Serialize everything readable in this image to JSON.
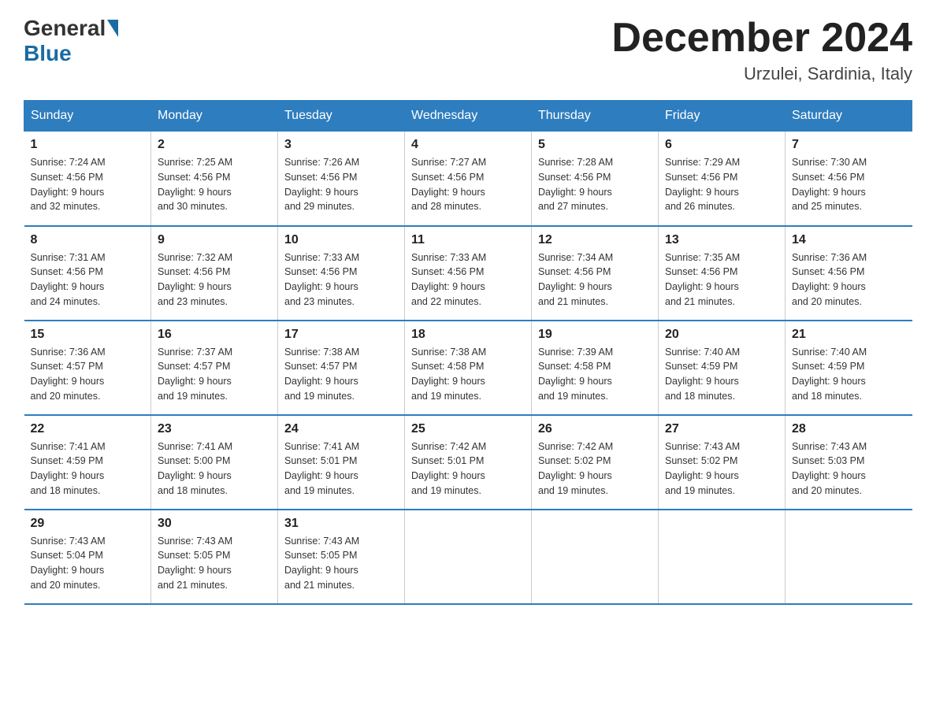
{
  "header": {
    "logo_general": "General",
    "logo_blue": "Blue",
    "month_title": "December 2024",
    "location": "Urzulei, Sardinia, Italy"
  },
  "days_of_week": [
    "Sunday",
    "Monday",
    "Tuesday",
    "Wednesday",
    "Thursday",
    "Friday",
    "Saturday"
  ],
  "weeks": [
    [
      {
        "day": "1",
        "sunrise": "7:24 AM",
        "sunset": "4:56 PM",
        "daylight": "9 hours and 32 minutes."
      },
      {
        "day": "2",
        "sunrise": "7:25 AM",
        "sunset": "4:56 PM",
        "daylight": "9 hours and 30 minutes."
      },
      {
        "day": "3",
        "sunrise": "7:26 AM",
        "sunset": "4:56 PM",
        "daylight": "9 hours and 29 minutes."
      },
      {
        "day": "4",
        "sunrise": "7:27 AM",
        "sunset": "4:56 PM",
        "daylight": "9 hours and 28 minutes."
      },
      {
        "day": "5",
        "sunrise": "7:28 AM",
        "sunset": "4:56 PM",
        "daylight": "9 hours and 27 minutes."
      },
      {
        "day": "6",
        "sunrise": "7:29 AM",
        "sunset": "4:56 PM",
        "daylight": "9 hours and 26 minutes."
      },
      {
        "day": "7",
        "sunrise": "7:30 AM",
        "sunset": "4:56 PM",
        "daylight": "9 hours and 25 minutes."
      }
    ],
    [
      {
        "day": "8",
        "sunrise": "7:31 AM",
        "sunset": "4:56 PM",
        "daylight": "9 hours and 24 minutes."
      },
      {
        "day": "9",
        "sunrise": "7:32 AM",
        "sunset": "4:56 PM",
        "daylight": "9 hours and 23 minutes."
      },
      {
        "day": "10",
        "sunrise": "7:33 AM",
        "sunset": "4:56 PM",
        "daylight": "9 hours and 23 minutes."
      },
      {
        "day": "11",
        "sunrise": "7:33 AM",
        "sunset": "4:56 PM",
        "daylight": "9 hours and 22 minutes."
      },
      {
        "day": "12",
        "sunrise": "7:34 AM",
        "sunset": "4:56 PM",
        "daylight": "9 hours and 21 minutes."
      },
      {
        "day": "13",
        "sunrise": "7:35 AM",
        "sunset": "4:56 PM",
        "daylight": "9 hours and 21 minutes."
      },
      {
        "day": "14",
        "sunrise": "7:36 AM",
        "sunset": "4:56 PM",
        "daylight": "9 hours and 20 minutes."
      }
    ],
    [
      {
        "day": "15",
        "sunrise": "7:36 AM",
        "sunset": "4:57 PM",
        "daylight": "9 hours and 20 minutes."
      },
      {
        "day": "16",
        "sunrise": "7:37 AM",
        "sunset": "4:57 PM",
        "daylight": "9 hours and 19 minutes."
      },
      {
        "day": "17",
        "sunrise": "7:38 AM",
        "sunset": "4:57 PM",
        "daylight": "9 hours and 19 minutes."
      },
      {
        "day": "18",
        "sunrise": "7:38 AM",
        "sunset": "4:58 PM",
        "daylight": "9 hours and 19 minutes."
      },
      {
        "day": "19",
        "sunrise": "7:39 AM",
        "sunset": "4:58 PM",
        "daylight": "9 hours and 19 minutes."
      },
      {
        "day": "20",
        "sunrise": "7:40 AM",
        "sunset": "4:59 PM",
        "daylight": "9 hours and 18 minutes."
      },
      {
        "day": "21",
        "sunrise": "7:40 AM",
        "sunset": "4:59 PM",
        "daylight": "9 hours and 18 minutes."
      }
    ],
    [
      {
        "day": "22",
        "sunrise": "7:41 AM",
        "sunset": "4:59 PM",
        "daylight": "9 hours and 18 minutes."
      },
      {
        "day": "23",
        "sunrise": "7:41 AM",
        "sunset": "5:00 PM",
        "daylight": "9 hours and 18 minutes."
      },
      {
        "day": "24",
        "sunrise": "7:41 AM",
        "sunset": "5:01 PM",
        "daylight": "9 hours and 19 minutes."
      },
      {
        "day": "25",
        "sunrise": "7:42 AM",
        "sunset": "5:01 PM",
        "daylight": "9 hours and 19 minutes."
      },
      {
        "day": "26",
        "sunrise": "7:42 AM",
        "sunset": "5:02 PM",
        "daylight": "9 hours and 19 minutes."
      },
      {
        "day": "27",
        "sunrise": "7:43 AM",
        "sunset": "5:02 PM",
        "daylight": "9 hours and 19 minutes."
      },
      {
        "day": "28",
        "sunrise": "7:43 AM",
        "sunset": "5:03 PM",
        "daylight": "9 hours and 20 minutes."
      }
    ],
    [
      {
        "day": "29",
        "sunrise": "7:43 AM",
        "sunset": "5:04 PM",
        "daylight": "9 hours and 20 minutes."
      },
      {
        "day": "30",
        "sunrise": "7:43 AM",
        "sunset": "5:05 PM",
        "daylight": "9 hours and 21 minutes."
      },
      {
        "day": "31",
        "sunrise": "7:43 AM",
        "sunset": "5:05 PM",
        "daylight": "9 hours and 21 minutes."
      },
      null,
      null,
      null,
      null
    ]
  ],
  "labels": {
    "sunrise": "Sunrise:",
    "sunset": "Sunset:",
    "daylight": "Daylight:"
  }
}
